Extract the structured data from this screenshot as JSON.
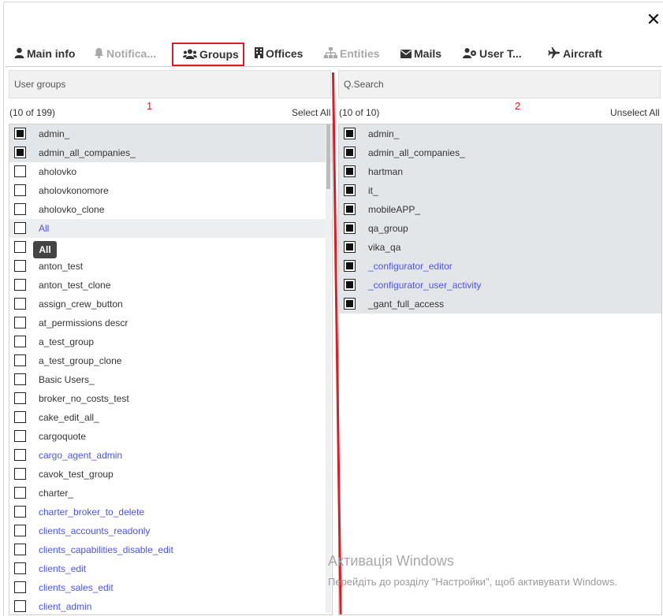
{
  "dialog": {
    "close_icon": "close-icon",
    "close_glyph": "✕"
  },
  "tabs": [
    {
      "label": "Main info",
      "icon": "user-icon",
      "disabled": false,
      "active": false
    },
    {
      "label": "Notifica...",
      "icon": "bell-icon",
      "disabled": true,
      "active": false
    },
    {
      "label": "Groups",
      "icon": "users-icon",
      "disabled": false,
      "active": true
    },
    {
      "label": "Offices",
      "icon": "building-icon",
      "disabled": false,
      "active": false
    },
    {
      "label": "Entities",
      "icon": "sitemap-icon",
      "disabled": true,
      "active": false
    },
    {
      "label": "Mails",
      "icon": "envelope-icon",
      "disabled": false,
      "active": false
    },
    {
      "label": "User T...",
      "icon": "user-gear-icon",
      "disabled": false,
      "active": false
    },
    {
      "label": "Aircraft",
      "icon": "plane-icon",
      "disabled": false,
      "active": false
    }
  ],
  "left": {
    "search_placeholder": "User groups",
    "count": "(10 of 199)",
    "select_all": "Select All",
    "marker": "1",
    "tooltip": "All",
    "items": [
      {
        "label": "admin_",
        "checked": true,
        "link": false
      },
      {
        "label": "admin_all_companies_",
        "checked": true,
        "link": false
      },
      {
        "label": "aholovko",
        "checked": false,
        "link": false
      },
      {
        "label": "aholovkonomore",
        "checked": false,
        "link": false
      },
      {
        "label": "aholovko_clone",
        "checked": false,
        "link": false
      },
      {
        "label": "All",
        "checked": false,
        "link": true,
        "hover": true
      },
      {
        "label": "_",
        "checked": false,
        "link": false
      },
      {
        "label": "anton_test",
        "checked": false,
        "link": false
      },
      {
        "label": "anton_test_clone",
        "checked": false,
        "link": false
      },
      {
        "label": "assign_crew_button",
        "checked": false,
        "link": false
      },
      {
        "label": "at_permissions descr",
        "checked": false,
        "link": false
      },
      {
        "label": "a_test_group",
        "checked": false,
        "link": false
      },
      {
        "label": "a_test_group_clone",
        "checked": false,
        "link": false
      },
      {
        "label": "Basic Users_",
        "checked": false,
        "link": false
      },
      {
        "label": "broker_no_costs_test",
        "checked": false,
        "link": false
      },
      {
        "label": "cake_edit_all_",
        "checked": false,
        "link": false
      },
      {
        "label": "cargoquote",
        "checked": false,
        "link": false
      },
      {
        "label": "cargo_agent_admin",
        "checked": false,
        "link": true
      },
      {
        "label": "cavok_test_group",
        "checked": false,
        "link": false
      },
      {
        "label": "charter_",
        "checked": false,
        "link": false
      },
      {
        "label": "charter_broker_to_delete",
        "checked": false,
        "link": true
      },
      {
        "label": "clients_accounts_readonly",
        "checked": false,
        "link": true
      },
      {
        "label": "clients_capabilities_disable_edit",
        "checked": false,
        "link": true
      },
      {
        "label": "clients_edit",
        "checked": false,
        "link": true
      },
      {
        "label": "clients_sales_edit",
        "checked": false,
        "link": true
      },
      {
        "label": "client_admin",
        "checked": false,
        "link": true
      }
    ]
  },
  "right": {
    "search_placeholder": "Q.Search",
    "count": "(10 of 10)",
    "unselect_all": "Unselect All",
    "marker": "2",
    "items": [
      {
        "label": "admin_",
        "checked": true,
        "link": false
      },
      {
        "label": "admin_all_companies_",
        "checked": true,
        "link": false
      },
      {
        "label": "hartman",
        "checked": true,
        "link": false
      },
      {
        "label": "it_",
        "checked": true,
        "link": false
      },
      {
        "label": "mobileAPP_",
        "checked": true,
        "link": false
      },
      {
        "label": "qa_group",
        "checked": true,
        "link": false
      },
      {
        "label": "vika_qa",
        "checked": true,
        "link": false
      },
      {
        "label": "_configurator_editor",
        "checked": true,
        "link": true
      },
      {
        "label": "_configurator_user_activity",
        "checked": true,
        "link": true
      },
      {
        "label": "_gant_full_access",
        "checked": true,
        "link": false
      }
    ]
  },
  "watermark": {
    "title": "Активація Windows",
    "subtitle": "Перейдіть до розділу \"Настройки\", щоб активувати Windows."
  },
  "colors": {
    "accent_red": "#e11b22",
    "link_blue": "#4b55e6",
    "selected_row": "#e3e6e9"
  }
}
